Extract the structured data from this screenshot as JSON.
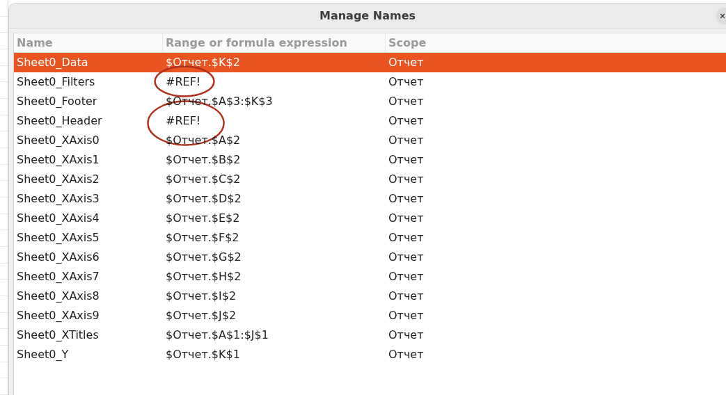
{
  "window": {
    "title": "Manage Names"
  },
  "table": {
    "columns": [
      "Name",
      "Range or formula expression",
      "Scope"
    ],
    "rows": [
      {
        "name": "Sheet0_Data",
        "range": "$Отчет.$K$2",
        "scope": "Отчет",
        "selected": true,
        "circled": false
      },
      {
        "name": "Sheet0_Filters",
        "range": "#REF!",
        "scope": "Отчет",
        "selected": false,
        "circled": true
      },
      {
        "name": "Sheet0_Footer",
        "range": "$Отчет.$A$3:$K$3",
        "scope": "Отчет",
        "selected": false,
        "circled": false
      },
      {
        "name": "Sheet0_Header",
        "range": "#REF!",
        "scope": "Отчет",
        "selected": false,
        "circled": true
      },
      {
        "name": "Sheet0_XAxis0",
        "range": "$Отчет.$A$2",
        "scope": "Отчет",
        "selected": false,
        "circled": false
      },
      {
        "name": "Sheet0_XAxis1",
        "range": "$Отчет.$B$2",
        "scope": "Отчет",
        "selected": false,
        "circled": false
      },
      {
        "name": "Sheet0_XAxis2",
        "range": "$Отчет.$C$2",
        "scope": "Отчет",
        "selected": false,
        "circled": false
      },
      {
        "name": "Sheet0_XAxis3",
        "range": "$Отчет.$D$2",
        "scope": "Отчет",
        "selected": false,
        "circled": false
      },
      {
        "name": "Sheet0_XAxis4",
        "range": "$Отчет.$E$2",
        "scope": "Отчет",
        "selected": false,
        "circled": false
      },
      {
        "name": "Sheet0_XAxis5",
        "range": "$Отчет.$F$2",
        "scope": "Отчет",
        "selected": false,
        "circled": false
      },
      {
        "name": "Sheet0_XAxis6",
        "range": "$Отчет.$G$2",
        "scope": "Отчет",
        "selected": false,
        "circled": false
      },
      {
        "name": "Sheet0_XAxis7",
        "range": "$Отчет.$H$2",
        "scope": "Отчет",
        "selected": false,
        "circled": false
      },
      {
        "name": "Sheet0_XAxis8",
        "range": "$Отчет.$I$2",
        "scope": "Отчет",
        "selected": false,
        "circled": false
      },
      {
        "name": "Sheet0_XAxis9",
        "range": "$Отчет.$J$2",
        "scope": "Отчет",
        "selected": false,
        "circled": false
      },
      {
        "name": "Sheet0_XTitles",
        "range": "$Отчет.$A$1:$J$1",
        "scope": "Отчет",
        "selected": false,
        "circled": false
      },
      {
        "name": "Sheet0_Y",
        "range": "$Отчет.$K$1",
        "scope": "Отчет",
        "selected": false,
        "circled": false
      }
    ]
  }
}
